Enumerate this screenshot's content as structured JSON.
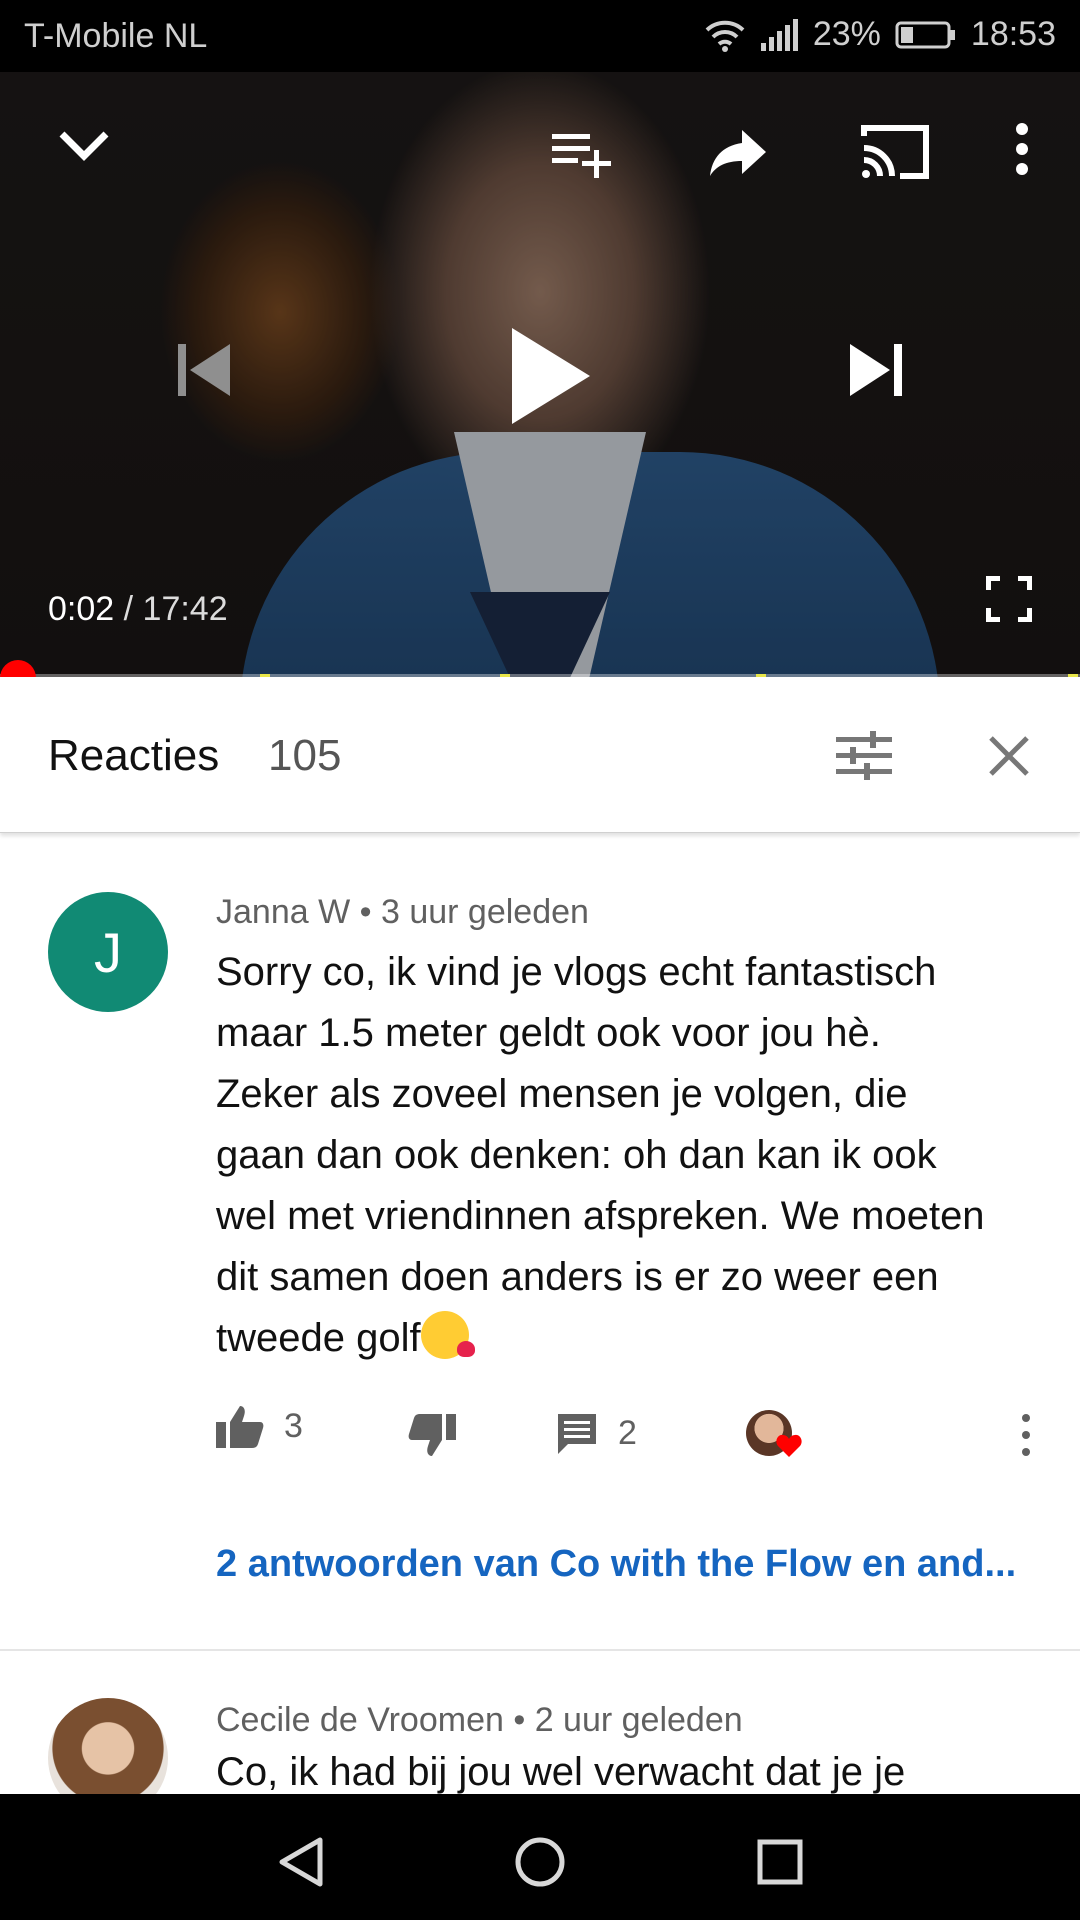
{
  "status_bar": {
    "carrier": "T-Mobile  NL",
    "battery": "23%",
    "time": "18:53"
  },
  "player": {
    "current_time": "0:02",
    "separator": " / ",
    "duration": "17:42",
    "progress_fraction": 0.0019,
    "icons": [
      "collapse-chevron-icon",
      "add-to-playlist-icon",
      "share-icon",
      "cast-icon",
      "more-vert-icon",
      "previous-icon",
      "play-icon",
      "next-icon",
      "fullscreen-icon"
    ]
  },
  "comments_header": {
    "title": "Reacties",
    "count": "105"
  },
  "comment1": {
    "avatar_letter": "J",
    "author": "Janna W",
    "meta_sep": " • ",
    "time": "3 uur geleden",
    "lines": [
      "Sorry co, ik vind je vlogs echt fantastisch",
      "maar 1.5 meter geldt ook voor jou hè.",
      "Zeker als zoveel mensen je volgen, die",
      "gaan dan ook denken: oh dan kan ik ook",
      "wel met vriendinnen afspreken. We moeten",
      "dit samen doen anders is er zo weer een",
      "tweede golf"
    ],
    "likes": "3",
    "reply_count": "2",
    "replies_link": "2 antwoorden van Co with the Flow en and..."
  },
  "comment2": {
    "author": "Cecile de Vroomen",
    "meta_sep": " • ",
    "time": "2 uur geleden",
    "text": "Co, ik had bij jou wel verwacht dat je je"
  },
  "colors": {
    "accent_red": "#ff0000",
    "link_blue": "#1565c0",
    "avatar_green": "#118a74"
  }
}
